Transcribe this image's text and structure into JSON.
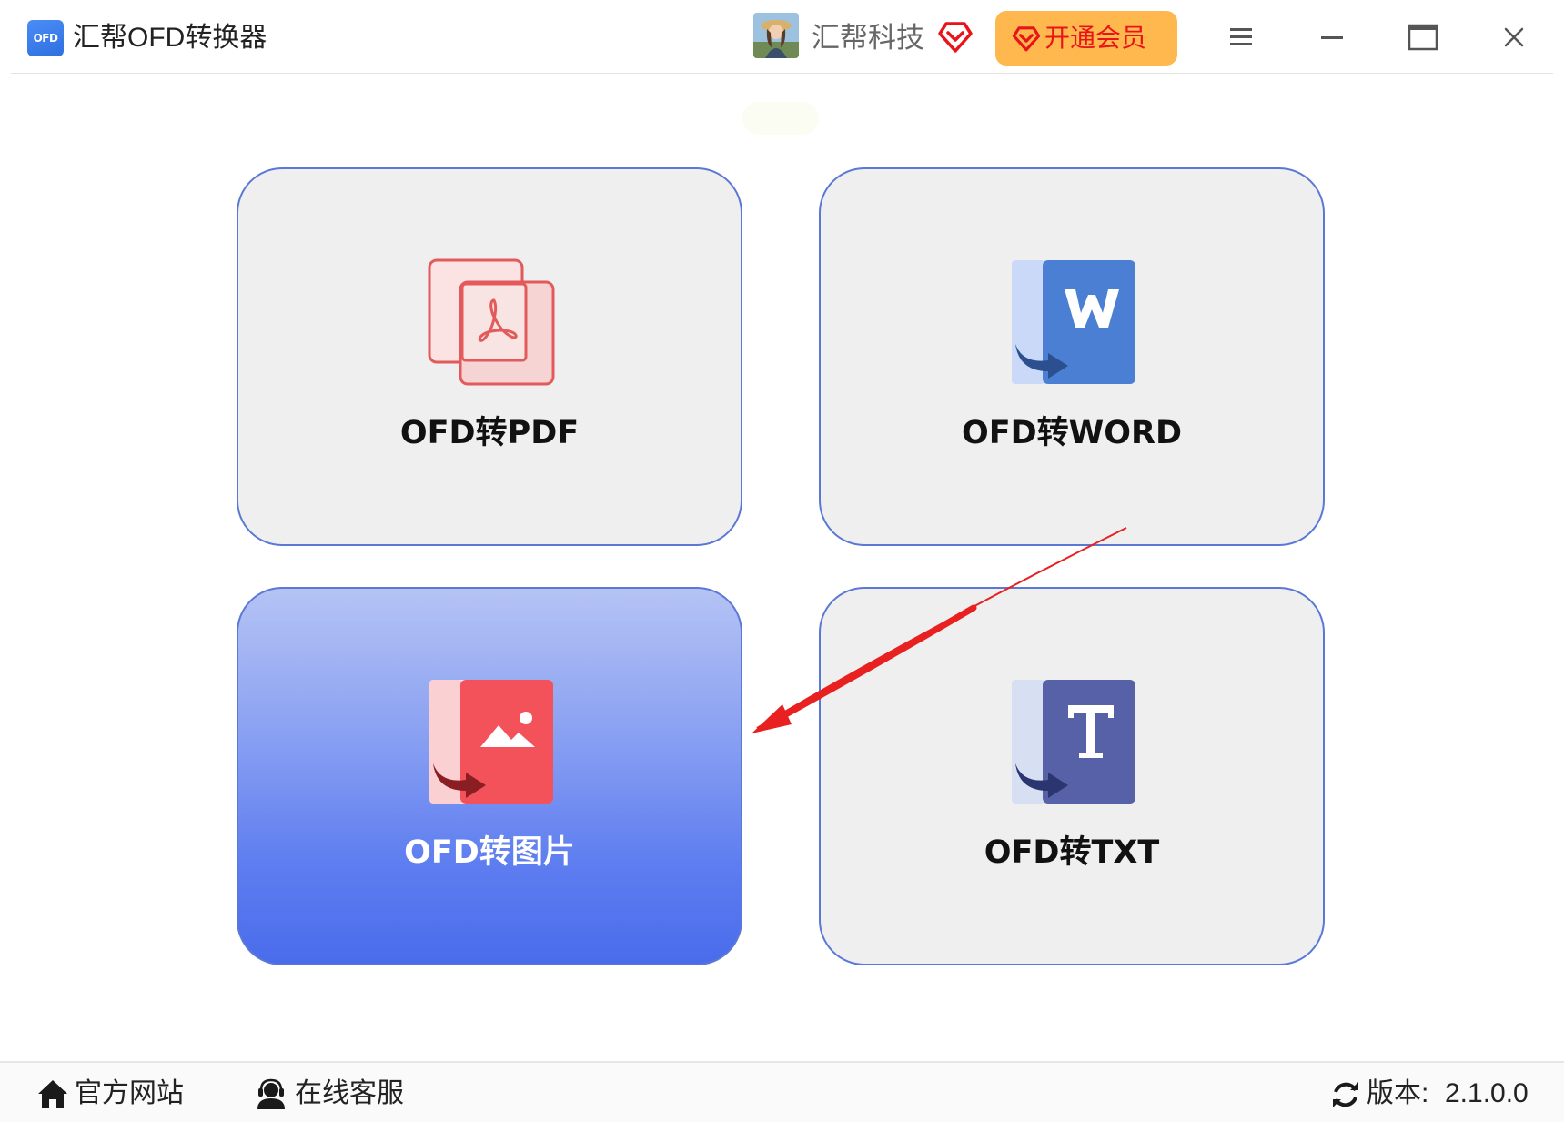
{
  "app": {
    "logo_text": "OFD",
    "title": "汇帮OFD转换器"
  },
  "header": {
    "username": "汇帮科技",
    "vip_button_label": "开通会员",
    "icons": {
      "avatar": "user-avatar",
      "vip": "diamond-heart-icon",
      "menu": "hamburger-menu-icon",
      "minimize": "minimize-icon",
      "maximize": "maximize-icon",
      "close": "close-icon"
    }
  },
  "tiles": [
    {
      "label": "OFD转PDF",
      "icon": "pdf-file-icon",
      "active": false
    },
    {
      "label": "OFD转WORD",
      "icon": "word-file-icon",
      "active": false
    },
    {
      "label": "OFD转图片",
      "icon": "image-file-icon",
      "active": true
    },
    {
      "label": "OFD转TXT",
      "icon": "txt-file-icon",
      "active": false
    }
  ],
  "footer": {
    "website_label": "官方网站",
    "support_label": "在线客服",
    "version_label": "版本:",
    "version_value": "2.1.0.0"
  },
  "colors": {
    "accent_border": "#5b78d6",
    "vip_button_bg": "#ffb84d",
    "vip_red": "#e8141a",
    "pdf_red": "#e25a5a",
    "word_blue": "#4a7fd4",
    "image_red": "#f4525a",
    "txt_indigo": "#5661a8",
    "active_tile_bottom": "#4a6ceb",
    "annotation_arrow": "#e8201f"
  }
}
